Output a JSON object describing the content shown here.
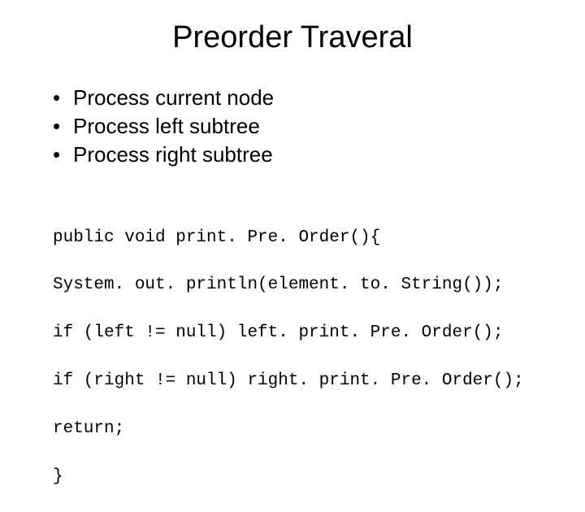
{
  "title": "Preorder Traveral",
  "bullets": [
    "Process current node",
    "Process left subtree",
    "Process right subtree"
  ],
  "code_lines": [
    "public void print. Pre. Order(){",
    "System. out. println(element. to. String());",
    "if (left != null) left. print. Pre. Order();",
    "if (right != null) right. print. Pre. Order();",
    "return;",
    "}"
  ]
}
